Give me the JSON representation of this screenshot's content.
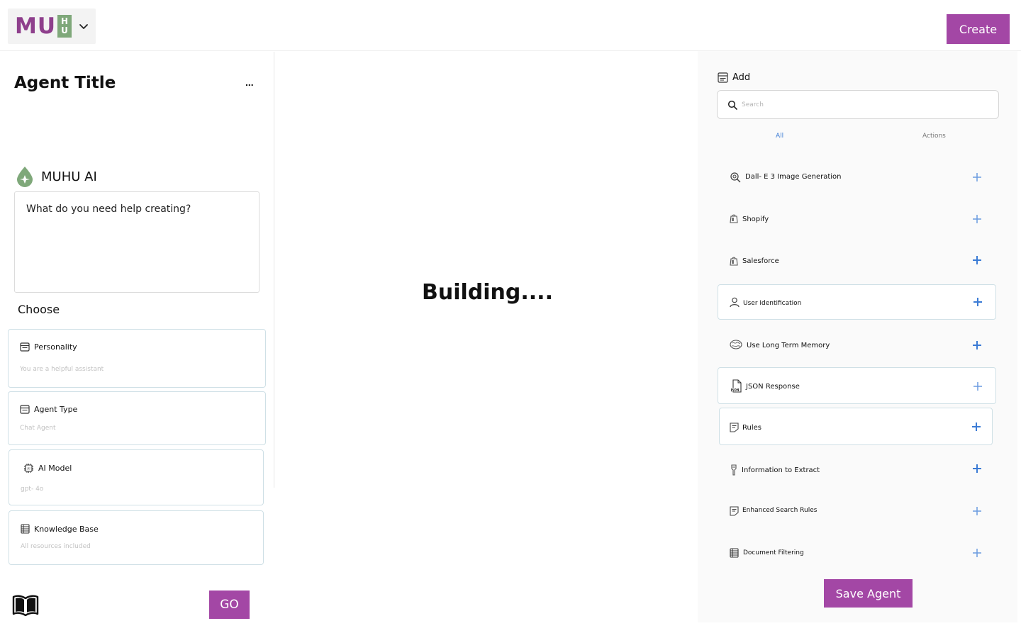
{
  "brand": {
    "logo_main": "MU",
    "logo_box_top": "H",
    "logo_box_bottom": "U"
  },
  "header": {
    "create_label": "Create"
  },
  "left": {
    "agent_title": "Agent Title",
    "more_label": "...",
    "ai_label": "MUHU AI",
    "prompt_placeholder": "What do you need help creating?",
    "choose_label": "Choose",
    "options": [
      {
        "title": "Personality",
        "value": "You are a helpful assistant"
      },
      {
        "title": "Agent Type",
        "value": "Chat Agent"
      },
      {
        "title": "AI Model",
        "value": "gpt- 4o"
      },
      {
        "title": "Knowledge Base",
        "value": "All resources included"
      }
    ],
    "go_label": "GO"
  },
  "center": {
    "status": "Building...."
  },
  "right": {
    "add_label": "Add",
    "search_placeholder": "Search",
    "tabs": [
      "All",
      "Actions"
    ],
    "tools": [
      {
        "label": "Dall- E 3 Image Generation",
        "icon": "image-search-icon"
      },
      {
        "label": "Shopify",
        "icon": "bag-icon"
      },
      {
        "label": "Salesforce",
        "icon": "bag-icon"
      },
      {
        "label": "User Identification",
        "icon": "user-icon"
      },
      {
        "label": "Use Long Term Memory",
        "icon": "brain-icon"
      },
      {
        "label": "JSON Response",
        "icon": "json-file-icon"
      },
      {
        "label": "Rules",
        "icon": "rules-icon"
      },
      {
        "label": "Information to Extract",
        "icon": "extract-icon"
      },
      {
        "label": "Enhanced Search Rules",
        "icon": "rules-icon"
      },
      {
        "label": "Document Filtering",
        "icon": "document-icon"
      }
    ],
    "save_label": "Save Agent"
  },
  "colors": {
    "accent": "#a347a5",
    "logo_purple": "#8e3f8c",
    "logo_green": "#7fa87a",
    "link_blue": "#3b7bd5",
    "plus_blue": "#3b7bd5"
  }
}
